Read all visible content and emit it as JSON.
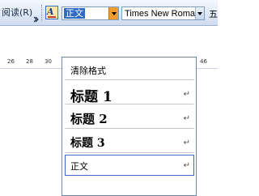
{
  "toolbar": {
    "read_label": "阅读(R)",
    "style_value": "正文",
    "font_value": "Times New Roman",
    "size_label": "五"
  },
  "ruler": {
    "ticks": [
      "26",
      "28",
      "30",
      "46"
    ]
  },
  "style_menu": {
    "items": [
      {
        "label": "清除格式",
        "kind": "clear"
      },
      {
        "label": "标题 1",
        "kind": "heading",
        "mark": "↵"
      },
      {
        "label": "标题 2",
        "kind": "heading",
        "mark": "↵"
      },
      {
        "label": "标题 3",
        "kind": "heading",
        "mark": "↵"
      },
      {
        "label": "正文",
        "kind": "normal",
        "mark": "↵",
        "selected": true
      }
    ]
  },
  "colors": {
    "selection": "#316ac5",
    "dropdown_button": "#f29b2f",
    "toolbar_bg": "#dfe9f7"
  }
}
